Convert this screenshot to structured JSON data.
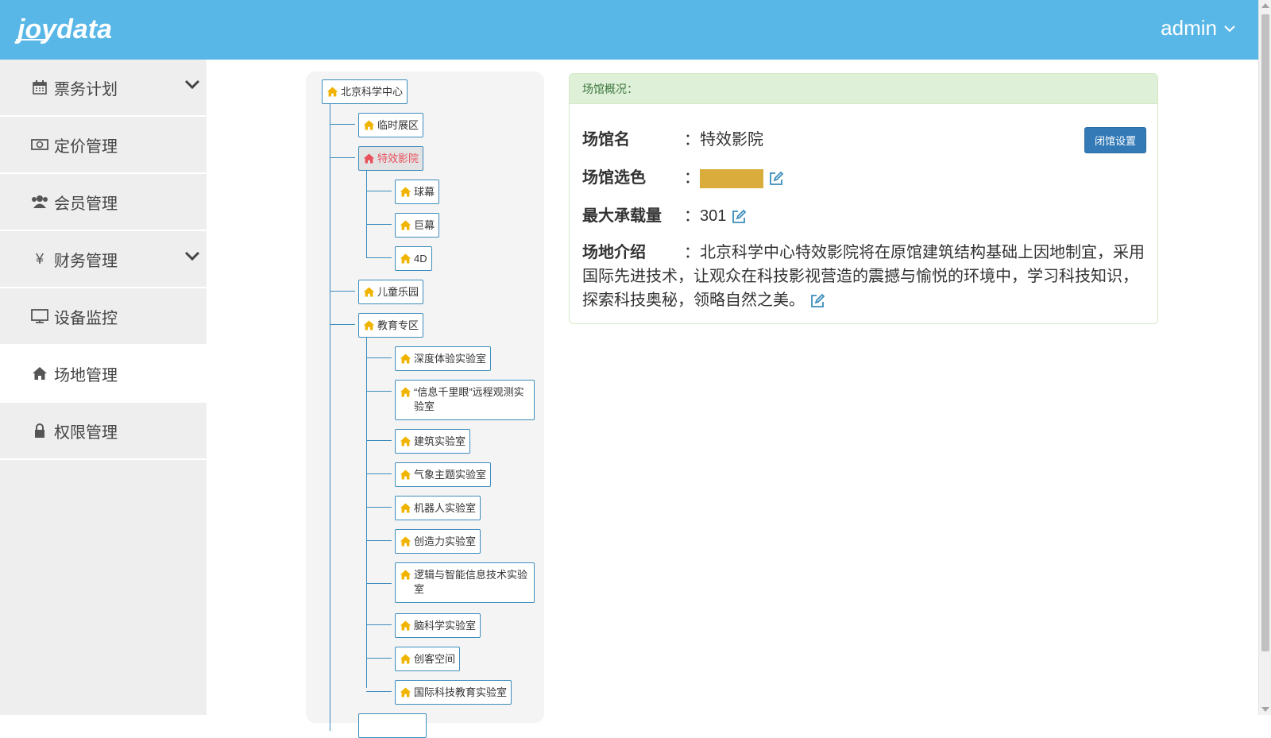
{
  "header": {
    "logo_text": "joydata",
    "user": "admin"
  },
  "sidebar": {
    "items": [
      {
        "label": "票务计划",
        "icon": "calendar-icon",
        "expandable": true,
        "active": false
      },
      {
        "label": "定价管理",
        "icon": "money-icon",
        "expandable": false,
        "active": false
      },
      {
        "label": "会员管理",
        "icon": "users-icon",
        "expandable": false,
        "active": false
      },
      {
        "label": "财务管理",
        "icon": "yen-icon",
        "expandable": true,
        "active": false
      },
      {
        "label": "设备监控",
        "icon": "monitor-icon",
        "expandable": false,
        "active": false
      },
      {
        "label": "场地管理",
        "icon": "home-icon",
        "expandable": false,
        "active": true
      },
      {
        "label": "权限管理",
        "icon": "lock-icon",
        "expandable": false,
        "active": false
      }
    ]
  },
  "tree": {
    "root": "北京科学中心",
    "nodes": [
      "临时展区",
      "特效影院",
      "球幕",
      "巨幕",
      "4D",
      "儿童乐园",
      "教育专区",
      "深度体验实验室",
      "“信息千里眼”远程观测实验室",
      "建筑实验室",
      "气象主题实验室",
      "机器人实验室",
      "创造力实验室",
      "逻辑与智能信息技术实验室",
      "脑科学实验室",
      "创客空间",
      "国际科技教育实验室"
    ],
    "selected": "特效影院"
  },
  "venue": {
    "panel_title": "场馆概况：",
    "name_label": "场馆名",
    "name_value": "特效影院",
    "color_label": "场馆选色",
    "color_value": "#d9ac3b",
    "capacity_label": "最大承载量",
    "capacity_value": "301",
    "intro_label": "场地介绍",
    "intro_value": "北京科学中心特效影院将在原馆建筑结构基础上因地制宜，采用国际先进技术，让观众在科技影视营造的震撼与愉悦的环境中，学习科技知识，探索科技奥秘，领略自然之美。",
    "colon": "：",
    "close_button": "闭馆设置"
  },
  "colors": {
    "header_bg": "#58b7e6",
    "sidebar_bg": "#eeeeee",
    "node_border": "#3c8dbc",
    "home_icon": "#f0b400",
    "selected_text": "#e8515c",
    "panel_head_bg": "#dff0d8",
    "button_bg": "#337ab7"
  }
}
